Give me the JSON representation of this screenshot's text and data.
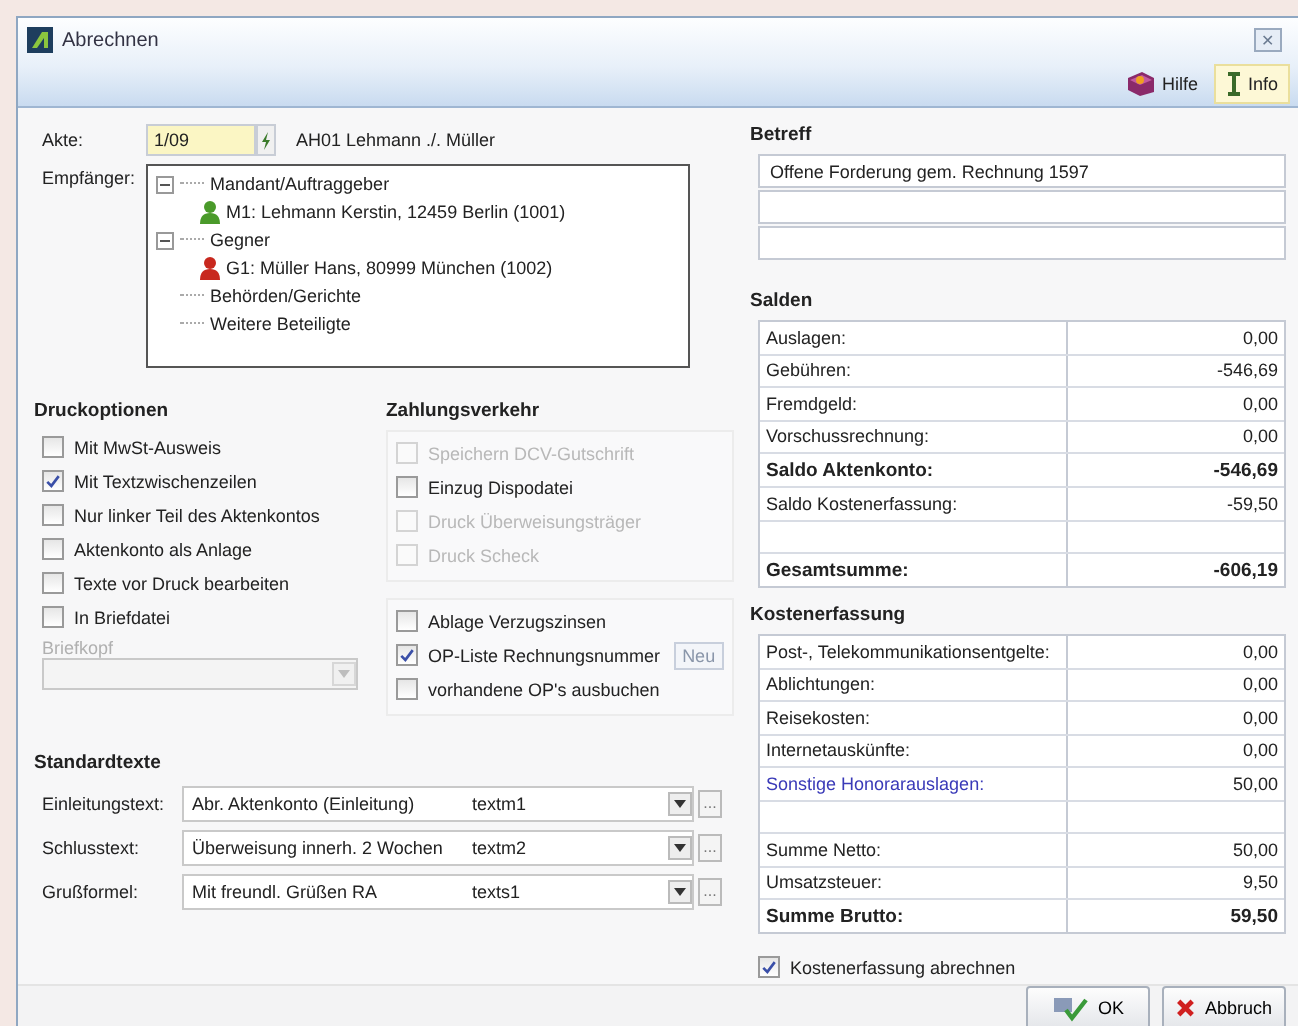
{
  "window": {
    "title": "Abrechnen",
    "close_label": "✕"
  },
  "toolbar": [
    {
      "label": "Hilfe",
      "kind": "help",
      "selected": false
    },
    {
      "label": "Info",
      "kind": "info",
      "selected": true
    }
  ],
  "akte": {
    "label": "Akte:",
    "value": "1/09",
    "description": "AH01 Lehmann ./. Müller"
  },
  "empfaenger": {
    "label": "Empfänger:",
    "tree": [
      {
        "label": "Mandant/Auftraggeber",
        "expanded": true,
        "children": [
          {
            "label": "M1: Lehmann Kerstin, 12459 Berlin (1001)",
            "color": "#4a9a2a"
          }
        ]
      },
      {
        "label": "Gegner",
        "expanded": true,
        "children": [
          {
            "label": "G1: Müller Hans, 80999 München (1002)",
            "color": "#c8281e"
          }
        ]
      },
      {
        "label": "Behörden/Gerichte"
      },
      {
        "label": "Weitere Beteiligte"
      }
    ]
  },
  "druckoptionen": {
    "title": "Druckoptionen",
    "options": [
      {
        "label": "Mit MwSt-Ausweis",
        "checked": false,
        "disabled": false
      },
      {
        "label": "Mit Textzwischenzeilen",
        "checked": true,
        "disabled": false
      },
      {
        "label": "Nur linker Teil des Aktenkontos",
        "checked": false,
        "disabled": false
      },
      {
        "label": "Aktenkonto als Anlage",
        "checked": false,
        "disabled": false
      },
      {
        "label": "Texte vor Druck bearbeiten",
        "checked": false,
        "disabled": false
      },
      {
        "label": "In Briefdatei",
        "checked": false,
        "disabled": false
      }
    ],
    "briefkopf": {
      "label": "Briefkopf",
      "disabled": true
    }
  },
  "zahlungsverkehr": {
    "title": "Zahlungsverkehr",
    "options": [
      {
        "label": "Speichern DCV-Gutschrift",
        "checked": false,
        "disabled": true
      },
      {
        "label": "Einzug Dispodatei",
        "checked": false,
        "disabled": false
      },
      {
        "label": "Druck Überweisungsträger",
        "checked": false,
        "disabled": true
      },
      {
        "label": "Druck Scheck",
        "checked": false,
        "disabled": true
      }
    ],
    "options2": [
      {
        "label": "Ablage Verzugszinsen",
        "checked": false,
        "disabled": false
      },
      {
        "label": "OP-Liste  Rechnungsnummer",
        "checked": true,
        "disabled": false,
        "button": "Neu"
      },
      {
        "label": "vorhandene OP's ausbuchen",
        "checked": false,
        "disabled": false
      }
    ]
  },
  "standardtexte": {
    "title": "Standardtexte",
    "rows": [
      {
        "label": "Einleitungstext:",
        "value": "Abr. Aktenkonto (Einleitung)",
        "code": "textm1",
        "more": "..."
      },
      {
        "label": "Schlusstext:",
        "value": "Überweisung innerh. 2 Wochen",
        "code": "textm2",
        "more": "..."
      },
      {
        "label": "Grußformel:",
        "value": "Mit freundl. Grüßen RA",
        "code": "texts1",
        "more": "..."
      }
    ]
  },
  "betreff": {
    "title": "Betreff",
    "lines": [
      "Offene Forderung gem. Rechnung 1597"
    ]
  },
  "salden": {
    "title": "Salden",
    "rows": [
      {
        "label": "Auslagen:",
        "value": "0,00",
        "kind": "plain"
      },
      {
        "label": "Gebühren:",
        "value": "-546,69",
        "kind": "plain"
      },
      {
        "label": "Fremdgeld:",
        "value": "0,00",
        "kind": "plain"
      },
      {
        "label": "Vorschussrechnung:",
        "value": "0,00",
        "kind": "plain"
      },
      {
        "label": "Saldo Aktenkonto:",
        "value": "-546,69",
        "kind": "total"
      },
      {
        "label": "Saldo Kostenerfassung:",
        "value": "-59,50",
        "kind": "plain"
      },
      {
        "kind": "blank"
      },
      {
        "label": "Gesamtsumme:",
        "value": "-606,19",
        "kind": "total"
      }
    ]
  },
  "kostenerfassung": {
    "title": "Kostenerfassung",
    "rows": [
      {
        "label": "Post-, Telekommunikationsentgelte:",
        "value": "0,00",
        "kind": "plain"
      },
      {
        "label": "Ablichtungen:",
        "value": "0,00",
        "kind": "plain"
      },
      {
        "label": "Reisekosten:",
        "value": "0,00",
        "kind": "plain"
      },
      {
        "label": "Internetauskünfte:",
        "value": "0,00",
        "kind": "plain"
      },
      {
        "label": "Sonstige Honorarauslagen:",
        "value": "50,00",
        "kind": "link"
      },
      {
        "kind": "blank"
      },
      {
        "label": "Summe Netto:",
        "value": "50,00",
        "kind": "plain"
      },
      {
        "label": "Umsatzsteuer:",
        "value": "9,50",
        "kind": "plain"
      },
      {
        "label": "Summe Brutto:",
        "value": "59,50",
        "kind": "total"
      }
    ],
    "abrechnen": {
      "label": "Kostenerfassung abrechnen",
      "checked": true
    }
  },
  "buttons": [
    {
      "label": "OK",
      "kind": "ok"
    },
    {
      "label": "Abbruch",
      "kind": "cancel"
    }
  ]
}
